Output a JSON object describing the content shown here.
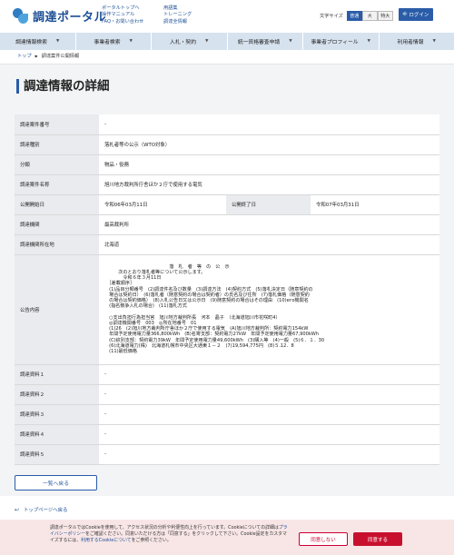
{
  "header": {
    "logo_text": "調達ポータル",
    "links_col1": [
      "ポータルトップへ",
      "操作マニュアル",
      "FAQ・お問い合わせ"
    ],
    "links_col2": [
      "用語集",
      "トレーニング",
      "調達全情報"
    ],
    "font_size_label": "文字サイズ",
    "font_sizes": [
      "普通",
      "大",
      "特大"
    ],
    "login_label": "ログイン"
  },
  "nav": {
    "items": [
      "調達情報検索",
      "事業者検索",
      "入札・契約",
      "統一資格審査申請",
      "事業者プロフィール",
      "利用者情報"
    ]
  },
  "breadcrumb": {
    "top": "トップ",
    "current": "調達案件公開情報"
  },
  "page_title": "調達情報の詳細",
  "detail": {
    "case_number_label": "調達案件番号",
    "case_number_value": "-",
    "type_label": "調達種別",
    "type_value": "落札者等の公示（WTO対象）",
    "category_label": "分類",
    "category_value": "物品・役務",
    "case_name_label": "調達案件名称",
    "case_name_value": "旭川地方裁判所庁舎ほか２庁で使用する電気",
    "pub_start_label": "公開開始日",
    "pub_start_value": "令和06年03月11日",
    "pub_end_label": "公開終了日",
    "pub_end_value": "令和07年03月31日",
    "agency_label": "調達機関",
    "agency_value": "最高裁判所",
    "location_label": "調達機関所在地",
    "location_value": "北海道",
    "notice_label": "公告内容",
    "notice_text": "　　　　　　　　　　　　　　落　札　者　等　の　公　示\n　　　次のとおり落札者等について公示します。\n　　　　令和６年３月11日\n　［差載順序］\n　(1)品目分類番号　(2)調達件名及び数量　(3)調達方法　(4)契約方式　(5)落札決定日（随意契約の\n　場合は契約日）　(6)落札者（随意契約の場合は契約者）の氏名及び住所　(7)落札価格（随意契約\n　の場合は契約価格）　(8)入札公告日又は公示日　(9)随意契約の場合はその理由　(10)его機関名\n　(指名競争入札の場合)　(11)落札方式\n\n　○支出負担行為担当官　旭川地方裁判所長　河本　晶子　（北海道旭川市花咲町4）\n　◎調達機関番号　003　◎所在地番号　01\n　(1)26　(2)旭川地方裁判所庁舎ほか２庁で使用する電気　(A)旭川地方裁判所：契約電力154kW\n　年間予定使用電力量366,800kWh　(B)名寄支部：契約電力27kW　年間予定使用電力量67,900kWh\n　(C)紋別支部：契約電力39kW　年間予定使用電力量49,600kWh　(3)購入等　(4)一般　(5)６．１．30\n　(6)北海道電力(株)　北海道札幌市中央区大通東１－２　(7)19,594,775円　(8)５.12．8\n　(11)最低価格",
    "doc1_label": "調達資料１",
    "doc1_value": "-",
    "doc2_label": "調達資料２",
    "doc2_value": "-",
    "doc3_label": "調達資料３",
    "doc3_value": "-",
    "doc4_label": "調達資料４",
    "doc4_value": "-",
    "doc5_label": "調達資料５",
    "doc5_value": "-"
  },
  "back_label": "一覧へ戻る",
  "to_top_label": "トップページへ戻る",
  "cookie": {
    "text_1": "調達ポータルではCookieを使用して、アクセス状況の分析や利便性向上を行っています。Cookieについての詳細は",
    "privacy_link": "プライバシーポリシー",
    "text_2": "をご確認ください。同意いただける方は「同意する」をクリックして下さい。Cookie設定をカスタマイズするには、",
    "cookie_link": "利用するCookieについて",
    "text_3": "をご参照ください。",
    "decline_label": "同意しない",
    "accept_label": "同意する"
  }
}
